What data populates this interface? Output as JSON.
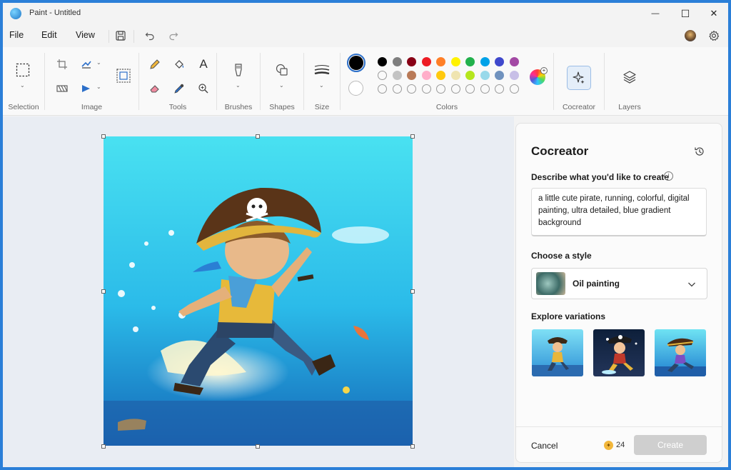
{
  "window": {
    "title": "Paint - Untitled",
    "minimize_glyph": "—",
    "maximize_glyph": "☐",
    "close_glyph": "✕"
  },
  "menu": {
    "file": "File",
    "edit": "Edit",
    "view": "View"
  },
  "ribbon": {
    "groups": {
      "selection": "Selection",
      "image": "Image",
      "tools": "Tools",
      "brushes": "Brushes",
      "shapes": "Shapes",
      "size": "Size",
      "colors": "Colors",
      "cocreator": "Cocreator",
      "layers": "Layers"
    },
    "text_tool_glyph": "A",
    "colors": {
      "primary": "#000000",
      "secondary": "#ffffff",
      "row1": [
        "#000000",
        "#7f7f7f",
        "#880015",
        "#ed1c24",
        "#ff7f27",
        "#fff200",
        "#22b14c",
        "#00a2e8",
        "#3f48cc",
        "#a349a4"
      ],
      "row2": [
        "#ffffff",
        "#c3c3c3",
        "#b97a57",
        "#ffaec9",
        "#ffc90e",
        "#efe4b0",
        "#b5e61d",
        "#99d9ea",
        "#7092be",
        "#c8bfe7"
      ],
      "row3_empty_count": 10
    }
  },
  "cocreator": {
    "title": "Cocreator",
    "prompt_label": "Describe what you'd like to create",
    "prompt_text": "a little cute pirate, running, colorful, digital painting, ultra detailed, blue gradient background",
    "style_label": "Choose a style",
    "style_value": "Oil painting",
    "variations_label": "Explore variations",
    "cancel_label": "Cancel",
    "credits": "24",
    "create_label": "Create"
  }
}
